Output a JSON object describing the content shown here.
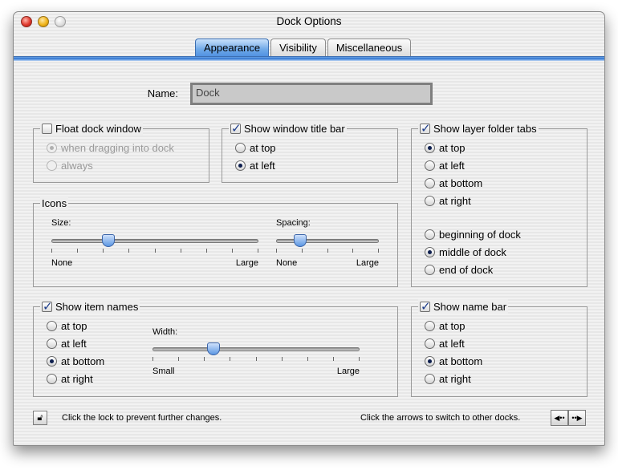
{
  "window": {
    "title": "Dock Options"
  },
  "tabs": [
    {
      "label": "Appearance",
      "active": true
    },
    {
      "label": "Visibility",
      "active": false
    },
    {
      "label": "Miscellaneous",
      "active": false
    }
  ],
  "name": {
    "label": "Name:",
    "value": "Dock"
  },
  "float": {
    "label": "Float dock window",
    "checked": false,
    "options": [
      {
        "label": "when dragging into dock",
        "selected": true,
        "enabled": false
      },
      {
        "label": "always",
        "selected": false,
        "enabled": false
      }
    ]
  },
  "titlebar": {
    "label": "Show window title bar",
    "checked": true,
    "options": [
      {
        "label": "at top",
        "selected": false
      },
      {
        "label": "at left",
        "selected": true
      }
    ]
  },
  "layertabs": {
    "label": "Show layer folder tabs",
    "checked": true,
    "position": [
      {
        "label": "at top",
        "selected": true
      },
      {
        "label": "at left",
        "selected": false
      },
      {
        "label": "at bottom",
        "selected": false
      },
      {
        "label": "at right",
        "selected": false
      }
    ],
    "alignment": [
      {
        "label": "beginning of dock",
        "selected": false
      },
      {
        "label": "middle of dock",
        "selected": true
      },
      {
        "label": "end of dock",
        "selected": false
      }
    ]
  },
  "icons": {
    "label": "Icons",
    "size": {
      "label": "Size:",
      "min": "None",
      "max": "Large",
      "value": 0.26
    },
    "spacing": {
      "label": "Spacing:",
      "min": "None",
      "max": "Large",
      "value": 0.2
    }
  },
  "itemnames": {
    "label": "Show item names",
    "checked": true,
    "options": [
      {
        "label": "at top",
        "selected": false
      },
      {
        "label": "at left",
        "selected": false
      },
      {
        "label": "at bottom",
        "selected": true
      },
      {
        "label": "at right",
        "selected": false
      }
    ],
    "width": {
      "label": "Width:",
      "min": "Small",
      "max": "Large",
      "value": 0.28
    }
  },
  "namebar": {
    "label": "Show name bar",
    "checked": true,
    "options": [
      {
        "label": "at top",
        "selected": false
      },
      {
        "label": "at left",
        "selected": false
      },
      {
        "label": "at bottom",
        "selected": true
      },
      {
        "label": "at right",
        "selected": false
      }
    ]
  },
  "footer": {
    "lock_text": "Click the lock to prevent further changes.",
    "arrows_text": "Click the arrows to switch to other docks."
  },
  "colors": {
    "accent": "#4b8de0",
    "tabline": "#2f73cf"
  }
}
